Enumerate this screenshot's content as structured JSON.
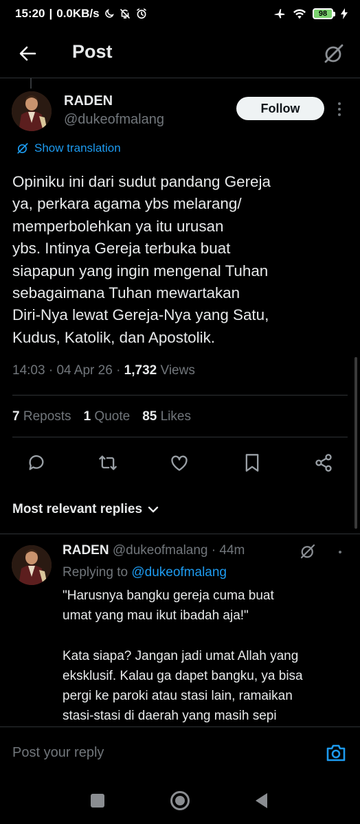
{
  "status_bar": {
    "time": "15:20",
    "network_speed": "0.0KB/s",
    "battery_level": "98",
    "icons": [
      "moon-icon",
      "notification-off-icon",
      "alarm-icon",
      "airplane-icon",
      "wifi-icon",
      "battery-icon",
      "charging-icon"
    ]
  },
  "header": {
    "title": "Post"
  },
  "post": {
    "author_name": "RADEN",
    "author_handle": "@dukeofmalang",
    "follow_label": "Follow",
    "show_translation": "Show translation",
    "text_lines": [
      "Opiniku ini dari sudut pandang Gereja",
      "ya, perkara agama ybs melarang/",
      "memperbolehkan ya itu urusan",
      "ybs. Intinya Gereja terbuka buat",
      "siapapun yang ingin mengenal Tuhan",
      "sebagaimana Tuhan mewartakan",
      "Diri-Nya lewat Gereja-Nya yang Satu,",
      "Kudus, Katolik, dan Apostolik."
    ],
    "time": "14:03",
    "date": "04 Apr 26",
    "views_count": "1,732",
    "views_label": "Views",
    "reposts_count": "7",
    "reposts_label": "Reposts",
    "quotes_count": "1",
    "quotes_label": "Quote",
    "likes_count": "85",
    "likes_label": "Likes"
  },
  "replies_section": {
    "sort_label": "Most relevant replies"
  },
  "reply": {
    "author_name": "RADEN",
    "author_handle": "@dukeofmalang",
    "age": "44m",
    "replying_to_label": "Replying to",
    "replying_to_handle": "@dukeofmalang",
    "text_lines": [
      "\"Harusnya bangku gereja cuma buat",
      "umat yang mau ikut ibadah aja!\"",
      "",
      "Kata siapa? Jangan jadi umat Allah yang",
      "eksklusif. Kalau ga dapet bangku, ya bisa",
      "pergi ke paroki atau stasi lain, ramaikan",
      "stasi-stasi di daerah yang masih sepi"
    ]
  },
  "compose": {
    "placeholder": "Post your reply"
  },
  "colors": {
    "background": "#000000",
    "text_primary": "#e7e9ea",
    "text_secondary": "#71767b",
    "accent": "#1d9bf0",
    "divider": "#2f3336"
  }
}
